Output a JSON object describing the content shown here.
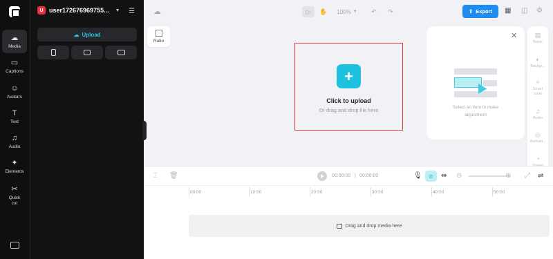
{
  "sidebar": {
    "items": [
      {
        "label": "Media",
        "icon": "cloud-upload-icon",
        "glyph": "☁",
        "active": true
      },
      {
        "label": "Captions",
        "icon": "captions-icon",
        "glyph": "▭",
        "active": false
      },
      {
        "label": "Avatars",
        "icon": "avatar-icon",
        "glyph": "☺",
        "active": false
      },
      {
        "label": "Text",
        "icon": "text-icon",
        "glyph": "T",
        "active": false
      },
      {
        "label": "Audio",
        "icon": "music-note-icon",
        "glyph": "♫",
        "active": false
      },
      {
        "label": "Elements",
        "icon": "elements-icon",
        "glyph": "✦",
        "active": false
      },
      {
        "label": "Quick cut",
        "icon": "scissors-icon",
        "glyph": "✂",
        "active": false
      }
    ]
  },
  "panel": {
    "user_initial": "U",
    "username": "user172676969755...",
    "upload_label": "Upload"
  },
  "toolbar": {
    "zoom": "100%",
    "export_label": "Export"
  },
  "canvas": {
    "ratio_label": "Ratio",
    "upload_title": "Click to upload",
    "upload_subtitle": "Or drag and drop file here"
  },
  "properties": {
    "placeholder": "Select an item to make adjustment"
  },
  "right_tabs": [
    {
      "label": "Basic",
      "icon": "basic-icon",
      "glyph": "▤"
    },
    {
      "label": "Backgr...",
      "icon": "background-icon",
      "glyph": "◐"
    },
    {
      "label": "Smart tools",
      "icon": "magic-wand-icon",
      "glyph": "✧"
    },
    {
      "label": "Audio",
      "icon": "music-note-icon",
      "glyph": "♫"
    },
    {
      "label": "Animati...",
      "icon": "animation-icon",
      "glyph": "◎"
    },
    {
      "label": "Speed",
      "icon": "speed-icon",
      "glyph": "◔"
    }
  ],
  "timeline": {
    "current_time": "00:00:00",
    "total_time": "00:00:00",
    "ruler": [
      "00:00",
      "10:00",
      "20:00",
      "30:00",
      "40:00",
      "50:00"
    ],
    "drop_label": "Drag and drop media here"
  },
  "colors": {
    "accent": "#1fc1e0",
    "export": "#1e8cf0",
    "dropzone_border": "#e23a3a"
  }
}
